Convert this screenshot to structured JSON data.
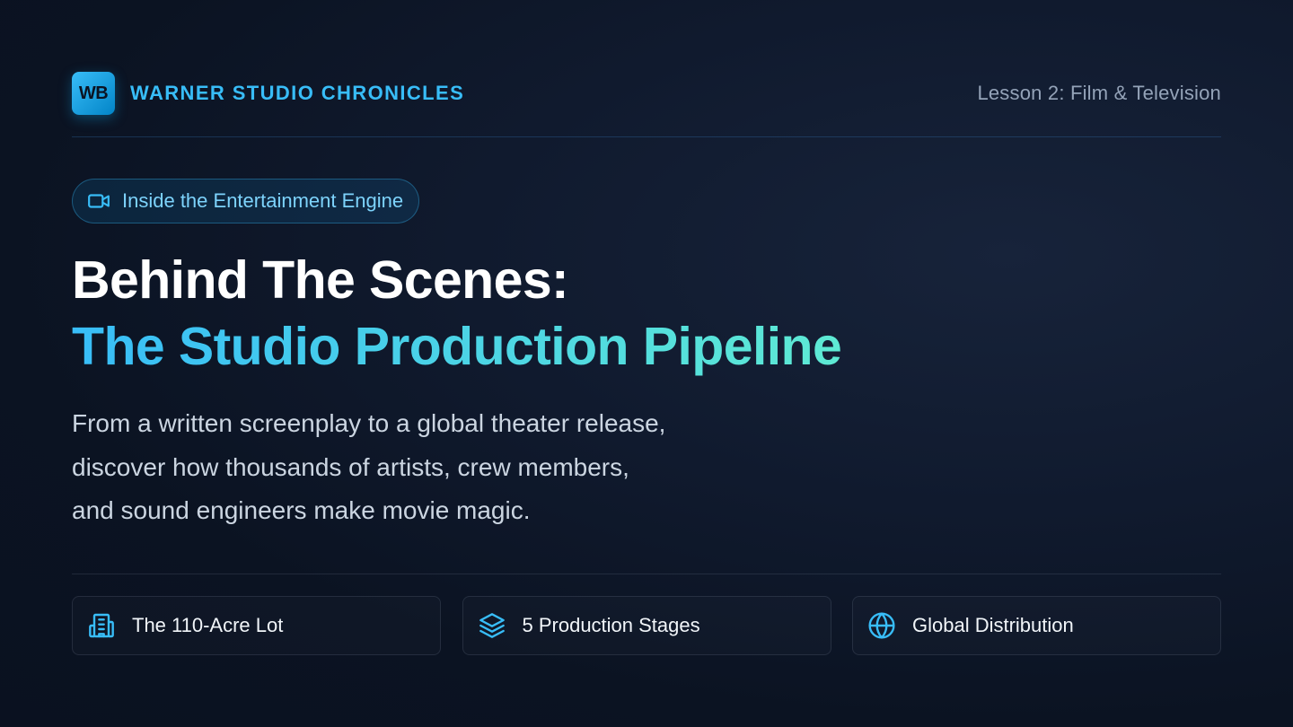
{
  "header": {
    "logo_text": "WB",
    "brand_name": "WARNER STUDIO CHRONICLES",
    "lesson": "Lesson 2: Film & Television"
  },
  "pill": {
    "icon": "video-camera-icon",
    "label": "Inside the Entertainment Engine"
  },
  "title": {
    "line1": "Behind The Scenes:",
    "line2": "The Studio Production Pipeline"
  },
  "description": {
    "lines": [
      "From a written screenplay to a global theater release,",
      "discover how thousands of artists, crew members,",
      "and sound engineers make movie magic."
    ]
  },
  "cards": [
    {
      "icon": "building-icon",
      "label": "The 110-Acre Lot"
    },
    {
      "icon": "layers-icon",
      "label": "5 Production Stages"
    },
    {
      "icon": "globe-icon",
      "label": "Global Distribution"
    }
  ],
  "colors": {
    "accent": "#38bdf8",
    "accent_gradient_end": "#5eead4",
    "background": "#0b1322",
    "muted_text": "#94a3b8"
  }
}
